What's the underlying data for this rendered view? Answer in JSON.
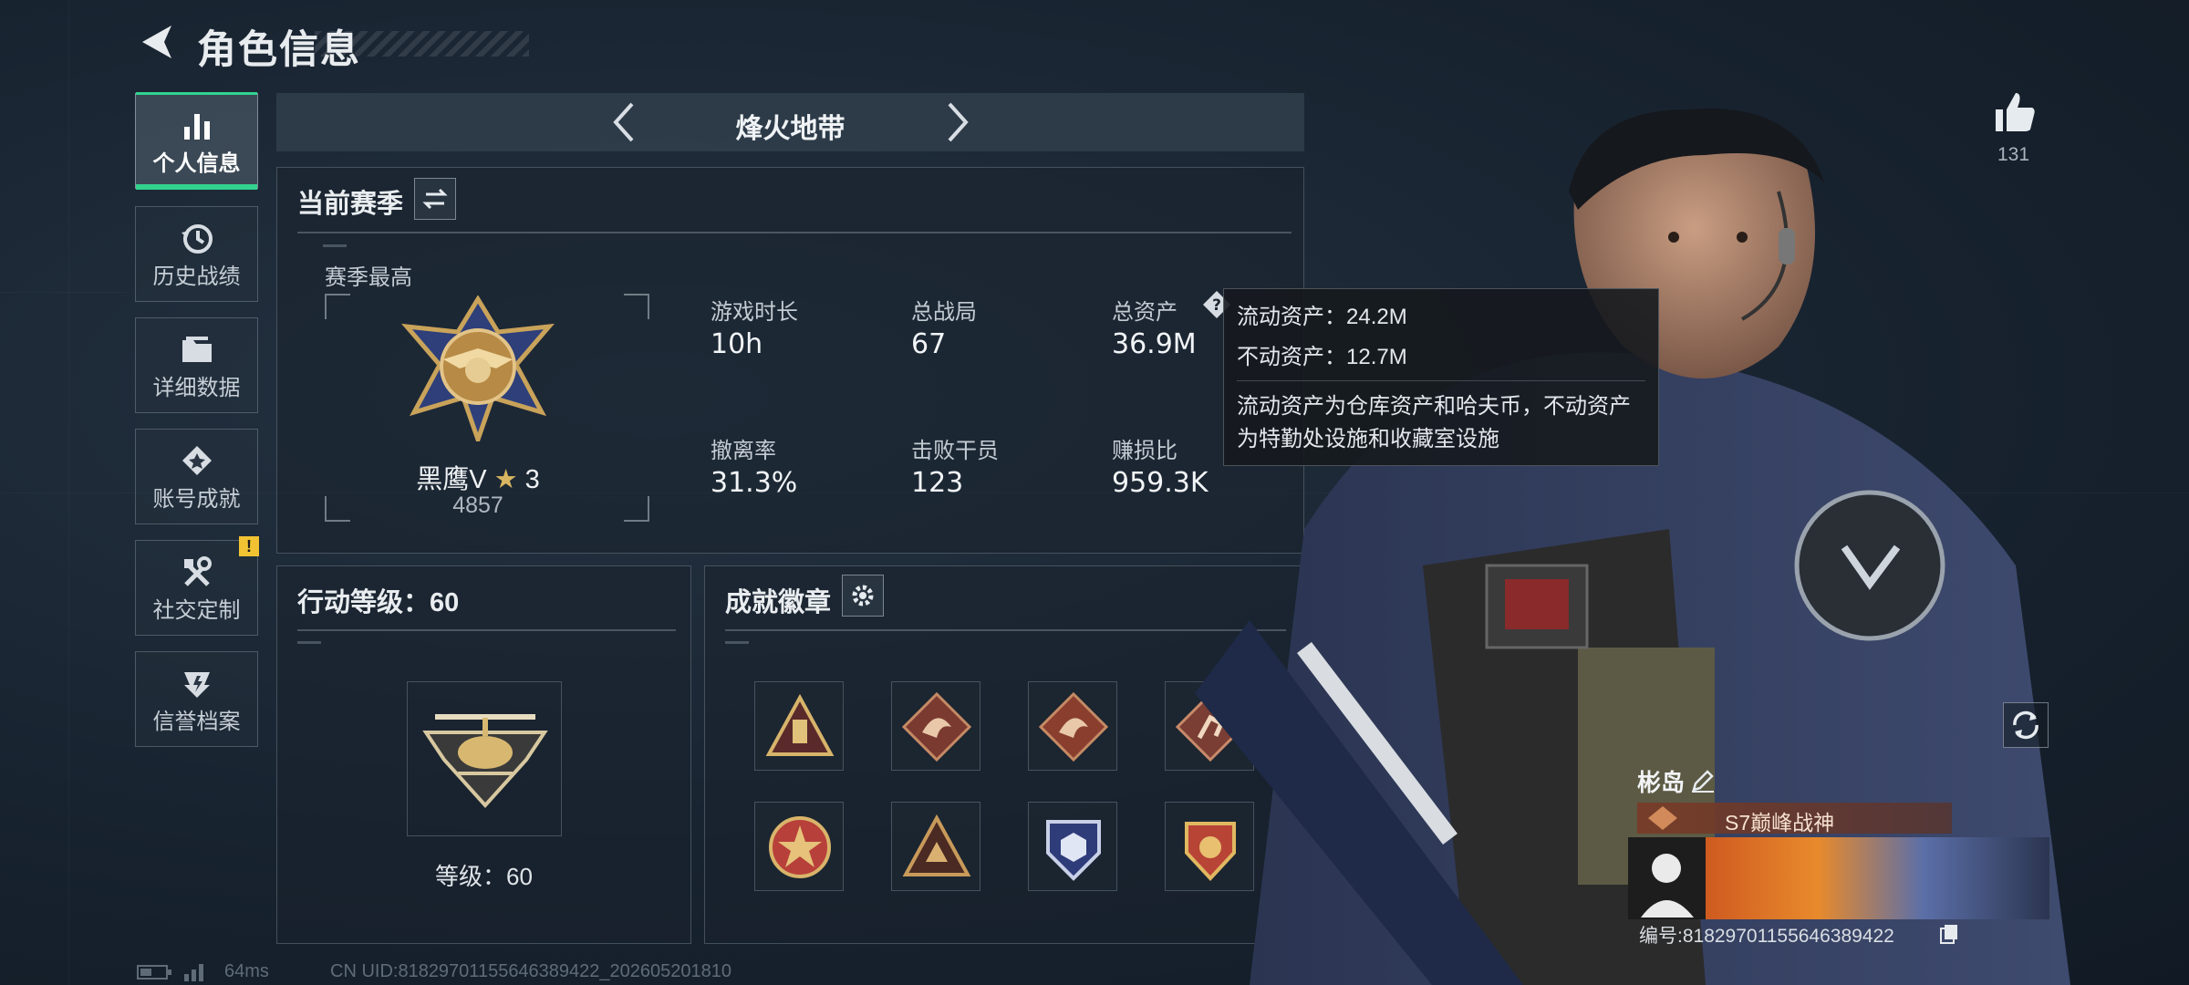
{
  "header": {
    "title": "角色信息"
  },
  "nav": {
    "items": [
      {
        "label": "个人信息",
        "icon": "bar-chart-icon",
        "active": true
      },
      {
        "label": "历史战绩",
        "icon": "history-clock-icon",
        "active": false
      },
      {
        "label": "详细数据",
        "icon": "folder-icon",
        "active": false
      },
      {
        "label": "账号成就",
        "icon": "achievement-icon",
        "active": false
      },
      {
        "label": "社交定制",
        "icon": "tools-icon",
        "active": false
      },
      {
        "label": "信誉档案",
        "icon": "credit-shield-icon",
        "active": false
      }
    ],
    "warning_badge": "!"
  },
  "mode": {
    "title": "烽火地带"
  },
  "season": {
    "title": "当前赛季",
    "best_label": "赛季最高",
    "rank_name": "黑鹰V",
    "rank_stars": "3",
    "rank_points": "4857",
    "stats": [
      {
        "label": "游戏时长",
        "value": "10h"
      },
      {
        "label": "总战局",
        "value": "67"
      },
      {
        "label": "总资产",
        "value": "36.9M"
      },
      {
        "label": "撤离率",
        "value": "31.3%"
      },
      {
        "label": "击败干员",
        "value": "123"
      },
      {
        "label": "赚损比",
        "value": "959.3K"
      }
    ]
  },
  "tooltip": {
    "liquid": "流动资产：24.2M",
    "fixed": "不动资产：12.7M",
    "desc_line1": "流动资产为仓库资产和哈夫币，不动资产",
    "desc_line2": "为特勤处设施和收藏室设施"
  },
  "action_level": {
    "title": "行动等级：60",
    "level_text": "等级：60"
  },
  "badges": {
    "title": "成就徽章",
    "count": 8
  },
  "likes": {
    "count": "131"
  },
  "profile": {
    "name": "彬岛",
    "title_badge": "S7巅峰战神",
    "id_text": "编号:8182970115564638942​2"
  },
  "footer": {
    "ping": "64ms",
    "uid": "CN UID:818297011556463894​22_202605201810"
  },
  "colors": {
    "accent": "#32d38f",
    "warning": "#f1c232"
  }
}
